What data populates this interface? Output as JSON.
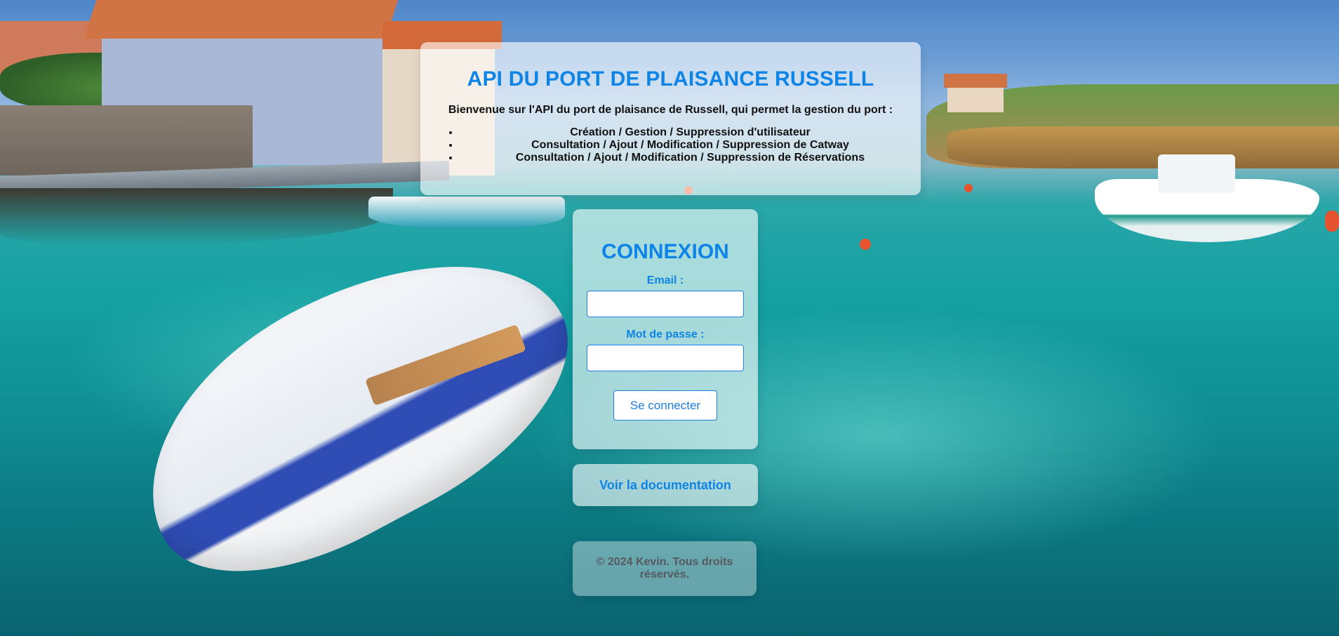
{
  "header": {
    "title": "API DU PORT DE PLAISANCE RUSSELL",
    "intro": "Bienvenue sur l'API du port de plaisance de Russell, qui permet la gestion du port :",
    "features": [
      "Création / Gestion / Suppression d'utilisateur",
      "Consultation / Ajout / Modification / Suppression de Catway",
      "Consultation / Ajout / Modification / Suppression de Réservations"
    ]
  },
  "login": {
    "title": "CONNEXION",
    "email_label": "Email :",
    "email_value": "",
    "password_label": "Mot de passe :",
    "password_value": "",
    "submit_label": "Se connecter"
  },
  "docs": {
    "link_label": "Voir la documentation"
  },
  "footer": {
    "text": "© 2024 Kevin. Tous droits réservés."
  },
  "colors": {
    "accent": "#0d84e6",
    "button_border": "#1e7de0",
    "panel_bg": "rgba(255,255,255,0.62)",
    "footer_text": "#555a60"
  }
}
